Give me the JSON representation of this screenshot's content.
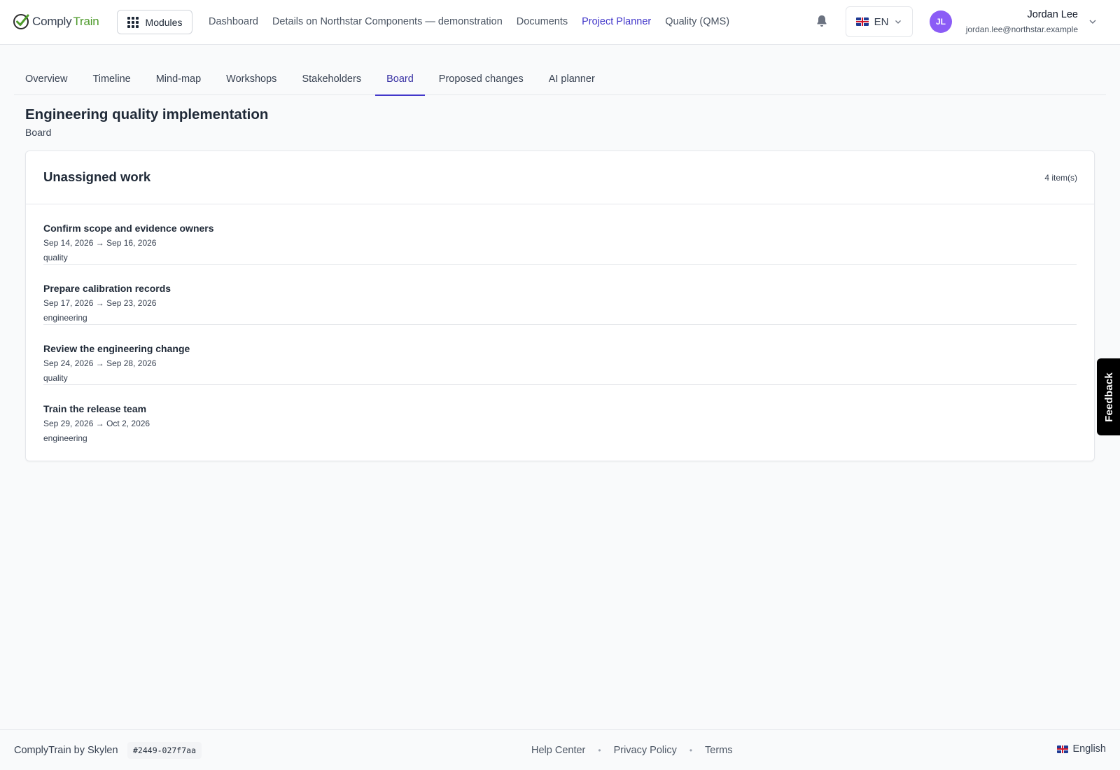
{
  "brand": {
    "logo_part1": "Comply",
    "logo_part2": "Train",
    "check_color": "#2d2d2d",
    "train_color": "#4d9a2a"
  },
  "header": {
    "modules_label": "Modules",
    "nav": [
      {
        "label": "Dashboard",
        "active": false
      },
      {
        "label": "Details on Northstar Components — demonstration",
        "active": false
      },
      {
        "label": "Documents",
        "active": false
      },
      {
        "label": "Project Planner",
        "active": true
      },
      {
        "label": "Quality (QMS)",
        "active": false
      }
    ],
    "language_code": "EN",
    "user": {
      "initials": "JL",
      "name": "Jordan Lee",
      "email": "jordan.lee@northstar.example",
      "avatar_color": "#8b5cf6"
    }
  },
  "tabs": [
    {
      "label": "Overview",
      "active": false
    },
    {
      "label": "Timeline",
      "active": false
    },
    {
      "label": "Mind-map",
      "active": false
    },
    {
      "label": "Workshops",
      "active": false
    },
    {
      "label": "Stakeholders",
      "active": false
    },
    {
      "label": "Board",
      "active": true
    },
    {
      "label": "Proposed changes",
      "active": false
    },
    {
      "label": "AI planner",
      "active": false
    }
  ],
  "page": {
    "title": "Engineering quality implementation",
    "subtitle": "Board"
  },
  "board": {
    "column_title": "Unassigned work",
    "item_count": "4 item(s)",
    "tasks": [
      {
        "title": "Confirm scope and evidence owners",
        "dates": "Sep 14, 2026 → Sep 16, 2026",
        "tag": "quality"
      },
      {
        "title": "Prepare calibration records",
        "dates": "Sep 17, 2026 → Sep 23, 2026",
        "tag": "engineering"
      },
      {
        "title": "Review the engineering change",
        "dates": "Sep 24, 2026 → Sep 28, 2026",
        "tag": "quality"
      },
      {
        "title": "Train the release team",
        "dates": "Sep 29, 2026 → Oct 2, 2026",
        "tag": "engineering"
      }
    ]
  },
  "feedback_label": "Feedback",
  "footer": {
    "brand": "ComplyTrain by Skylen",
    "build_hash": "#2449-027f7aa",
    "links": [
      "Help Center",
      "Privacy Policy",
      "Terms"
    ],
    "language": "English"
  },
  "colors": {
    "accent": "#4338ca",
    "background": "#f9fafb",
    "border": "#e5e7eb"
  }
}
